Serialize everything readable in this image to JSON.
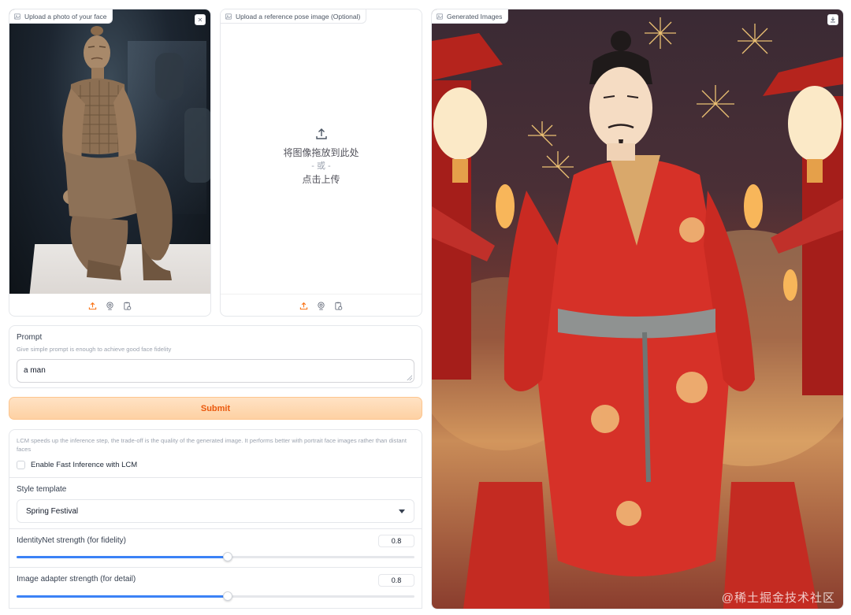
{
  "face_panel": {
    "label": "Upload a photo of your face",
    "clear_icon": "close-icon"
  },
  "pose_panel": {
    "label": "Upload a reference pose image (Optional)",
    "drop_text": "将图像拖放到此处",
    "or_text": "- 或 -",
    "click_text": "点击上传"
  },
  "output_panel": {
    "label": "Generated Images",
    "download_icon": "download-icon"
  },
  "source_toolbar": [
    "upload-icon",
    "webcam-icon",
    "clipboard-icon"
  ],
  "prompt": {
    "label": "Prompt",
    "info": "Give simple prompt is enough to achieve good face fidelity",
    "value": "a man"
  },
  "submit_label": "Submit",
  "lcm": {
    "info": "LCM speeds up the inference step, the trade-off is the quality of the generated image. It performs better with portrait face images rather than distant faces",
    "checkbox_label": "Enable Fast Inference with LCM",
    "checked": false
  },
  "style_template": {
    "label": "Style template",
    "value": "Spring Festival"
  },
  "identitynet": {
    "label": "IdentityNet strength (for fidelity)",
    "value": "0.8",
    "fraction": 0.53
  },
  "adapter": {
    "label": "Image adapter strength (for detail)",
    "value": "0.8",
    "fraction": 0.53
  },
  "watermark": "@稀土掘金技术社区",
  "colors": {
    "accent": "#f97316",
    "slider": "#3b82f6",
    "submit_bg": "#fed7aa"
  }
}
